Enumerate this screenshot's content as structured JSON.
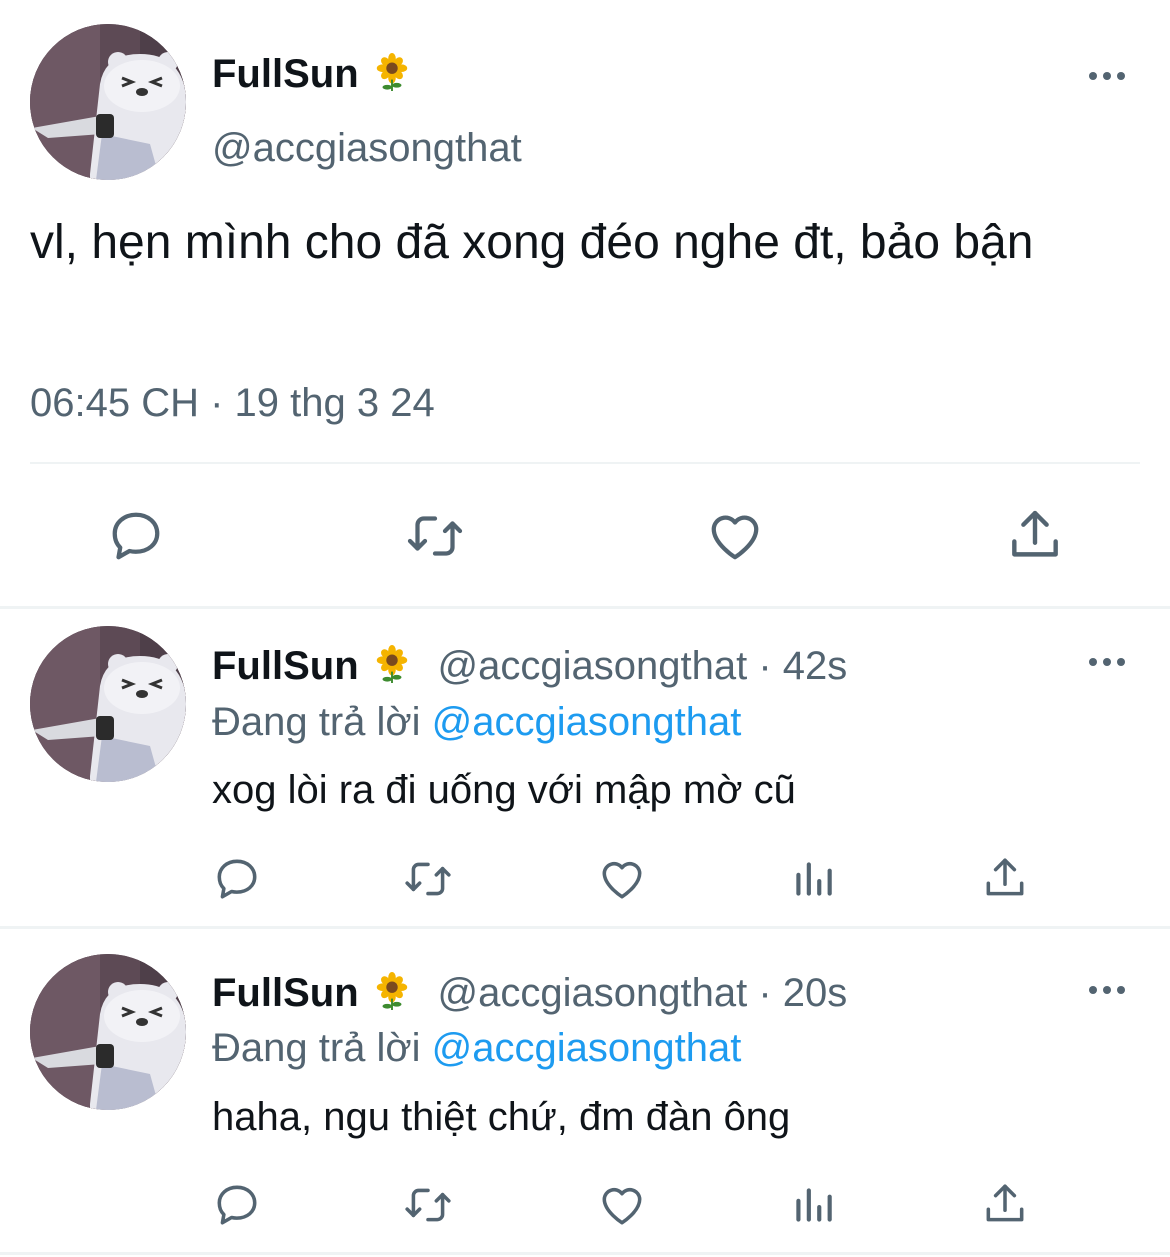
{
  "colors": {
    "text": "#0f1419",
    "secondary": "#536471",
    "accent": "#1d9bf0",
    "divider": "#eff3f4"
  },
  "main_tweet": {
    "display_name": "FullSun",
    "badge_emoji": "sunflower-icon",
    "handle": "@accgiasongthat",
    "text": "vl, hẹn mình cho đã xong đéo nghe đt, bảo bận",
    "timestamp": "06:45 CH · 19 thg 3 24",
    "actions": [
      "reply-icon",
      "retweet-icon",
      "like-icon",
      "share-icon"
    ]
  },
  "replies": [
    {
      "display_name": "FullSun",
      "handle": "@accgiasongthat · 42s",
      "reply_prefix": "Đang trả lời",
      "reply_to": "@accgiasongthat",
      "text": "xog lòi ra đi uống với mập mờ cũ",
      "actions": [
        "reply-icon",
        "retweet-icon",
        "like-icon",
        "views-icon",
        "share-icon"
      ]
    },
    {
      "display_name": "FullSun",
      "handle": "@accgiasongthat · 20s",
      "reply_prefix": "Đang trả lời",
      "reply_to": "@accgiasongthat",
      "text": "haha, ngu thiệt chứ, đm đàn ông",
      "actions": [
        "reply-icon",
        "retweet-icon",
        "like-icon",
        "views-icon",
        "share-icon"
      ]
    }
  ]
}
